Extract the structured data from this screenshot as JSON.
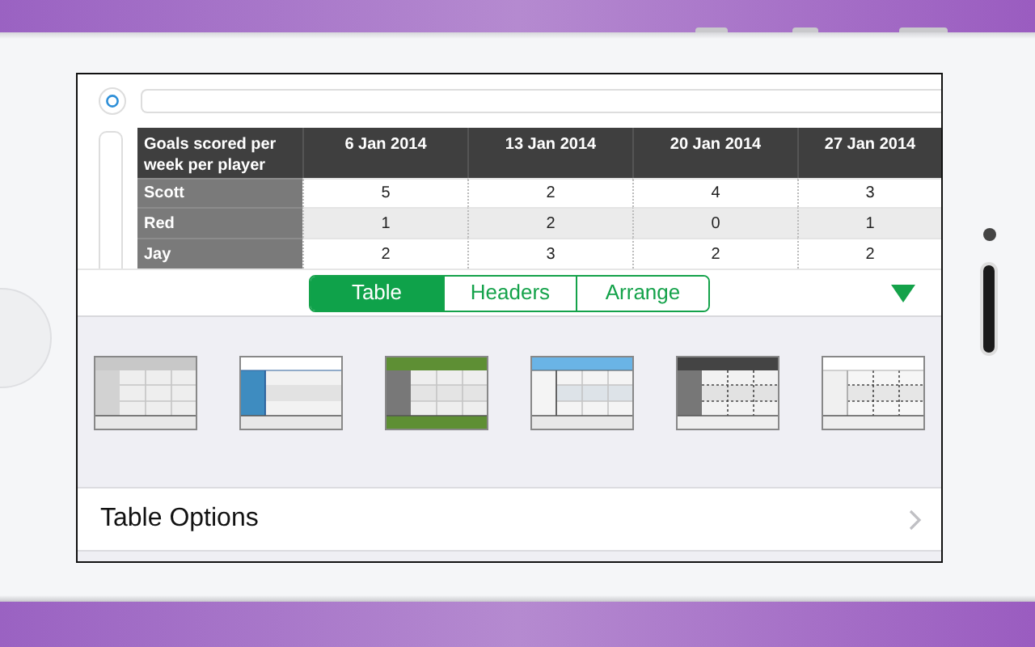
{
  "table": {
    "corner": "Goals scored per week per player",
    "columns": [
      "6 Jan 2014",
      "13 Jan 2014",
      "20 Jan 2014",
      "27 Jan 2014"
    ],
    "rows": [
      {
        "name": "Scott",
        "values": [
          "5",
          "2",
          "4",
          "3"
        ]
      },
      {
        "name": "Red",
        "values": [
          "1",
          "2",
          "0",
          "1"
        ]
      },
      {
        "name": "Jay",
        "values": [
          "2",
          "3",
          "2",
          "2"
        ]
      }
    ]
  },
  "tabs": [
    {
      "label": "Table",
      "selected": true
    },
    {
      "label": "Headers",
      "selected": false
    },
    {
      "label": "Arrange",
      "selected": false
    }
  ],
  "table_styles": [
    {
      "kind": "gray-header"
    },
    {
      "kind": "blue-column"
    },
    {
      "kind": "green-band"
    },
    {
      "kind": "blue-header"
    },
    {
      "kind": "dark-dotted"
    },
    {
      "kind": "light-dotted"
    }
  ],
  "options_row": {
    "label": "Table Options"
  }
}
